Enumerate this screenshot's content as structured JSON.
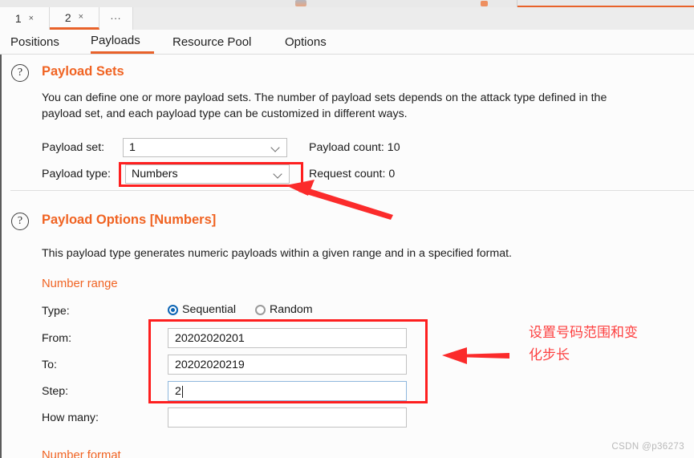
{
  "window": {
    "numbered_tabs": [
      {
        "label": "1",
        "close": "×",
        "active": false
      },
      {
        "label": "2",
        "close": "×",
        "active": true
      }
    ],
    "more_tab": "..."
  },
  "main_tabs": [
    {
      "label": "Positions",
      "active": false
    },
    {
      "label": "Payloads",
      "active": true
    },
    {
      "label": "Resource Pool",
      "active": false
    },
    {
      "label": "Options",
      "active": false
    }
  ],
  "payload_sets": {
    "help_glyph": "?",
    "title": "Payload Sets",
    "description_line1": "You can define one or more payload sets. The number of payload sets depends on the attack type defined in the",
    "description_line2": "payload set, and each payload type can be customized in different ways.",
    "payload_set_label": "Payload set:",
    "payload_set_value": "1",
    "payload_type_label": "Payload type:",
    "payload_type_value": "Numbers",
    "payload_count": "Payload count: 10",
    "request_count": "Request count: 0"
  },
  "payload_options": {
    "help_glyph": "?",
    "title": "Payload Options [Numbers]",
    "description": "This payload type generates numeric payloads within a given range and in a specified format.",
    "number_range_heading": "Number range",
    "type_label": "Type:",
    "type_options": [
      {
        "label": "Sequential",
        "selected": true
      },
      {
        "label": "Random",
        "selected": false
      }
    ],
    "from_label": "From:",
    "from_value": "20202020201",
    "to_label": "To:",
    "to_value": "20202020219",
    "step_label": "Step:",
    "step_value": "2",
    "how_many_label": "How many:",
    "how_many_value": "",
    "number_format_heading": "Number format"
  },
  "annotations": {
    "note_line1": "设置号码范围和变",
    "note_line2": "化步长",
    "highlight_color": "#fe1f1f",
    "accent_color": "#e8622a",
    "heading_color": "#f06322"
  },
  "watermark": "CSDN @p36273"
}
